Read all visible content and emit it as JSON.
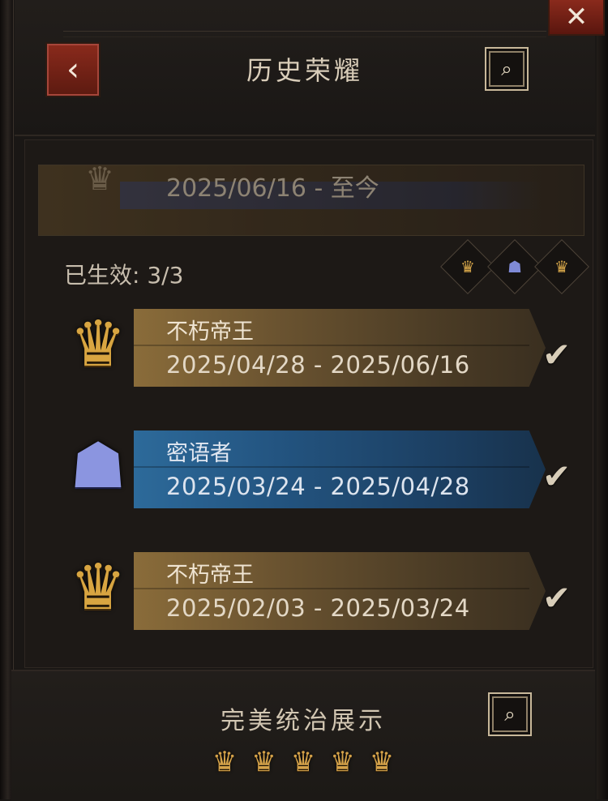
{
  "header": {
    "title": "历史荣耀",
    "back_glyph": "‹",
    "search_glyph": "⌕",
    "close_glyph": "✕"
  },
  "current": {
    "date_range": "2025/06/16 - 至今"
  },
  "active": {
    "label": "已生效: 3/3",
    "icons": [
      "gold-crown-icon",
      "blue-hooded-icon",
      "gold-crown-icon"
    ]
  },
  "records": [
    {
      "name": "不朽帝王",
      "date_range": "2025/04/28 - 2025/06/16",
      "theme": "gold",
      "check": "✔"
    },
    {
      "name": "密语者",
      "date_range": "2025/03/24 - 2025/04/28",
      "theme": "blue",
      "check": "✔"
    },
    {
      "name": "不朽帝王",
      "date_range": "2025/02/03 - 2025/03/24",
      "theme": "gold",
      "check": "✔"
    }
  ],
  "footer": {
    "title": "完美统治展示",
    "search_glyph": "⌕",
    "icon_count_glyph": "♛"
  },
  "colors": {
    "gold": "#d8a541",
    "blue": "#8b95e0",
    "red_button": "#8a2a1c"
  }
}
